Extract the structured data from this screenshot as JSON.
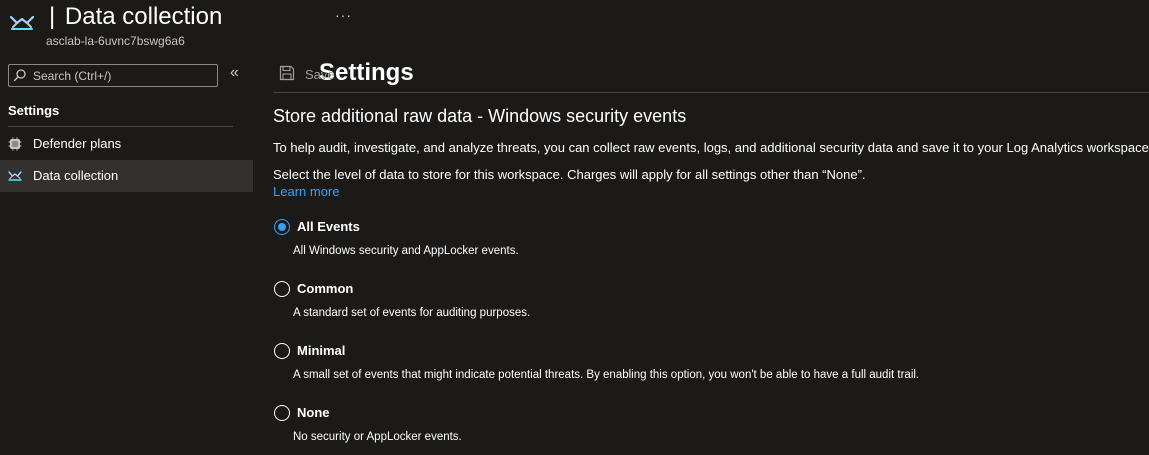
{
  "header": {
    "title_main": "Settings",
    "title_separator": "|",
    "title_section": "Data collection",
    "subtitle": "asclab-la-6uvnc7bswg6a6",
    "more_label": "···",
    "icon": "data-collection-icon"
  },
  "sidebar": {
    "search": {
      "placeholder": "Search (Ctrl+/)",
      "value": ""
    },
    "collapse_label": "«",
    "section_label": "Settings",
    "items": [
      {
        "label": "Defender plans",
        "icon": "defender-plans-icon",
        "selected": false
      },
      {
        "label": "Data collection",
        "icon": "data-collection-icon",
        "selected": true
      }
    ]
  },
  "toolbar": {
    "save_label": "Save",
    "save_icon": "save-icon"
  },
  "content": {
    "heading": "Store additional raw data - Windows security events",
    "description": "To help audit, investigate, and analyze threats, you can collect raw events, logs, and additional security data and save it to your Log Analytics workspace.",
    "select_text": "Select the level of data to store for this workspace. Charges will apply for all settings other than “None”.",
    "learn_more": "Learn more",
    "selected_option": "All Events",
    "options": [
      {
        "label": "All Events",
        "description": "All Windows security and AppLocker events."
      },
      {
        "label": "Common",
        "description": "A standard set of events for auditing purposes."
      },
      {
        "label": "Minimal",
        "description": "A small set of events that might indicate potential threats. By enabling this option, you won't be able to have a full audit trail."
      },
      {
        "label": "None",
        "description": "No security or AppLocker events."
      }
    ]
  },
  "colors": {
    "background": "#1b1a19",
    "selected_nav": "#323130",
    "accent": "#3aa0f3",
    "divider": "#484644"
  }
}
